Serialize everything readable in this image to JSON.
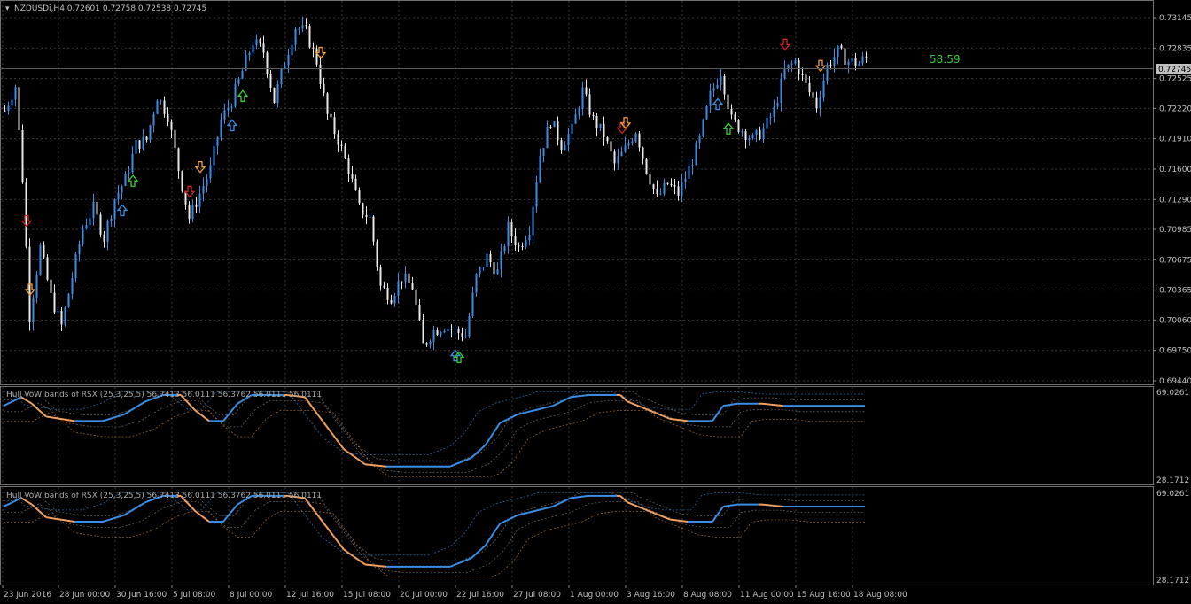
{
  "window": {
    "symbol_header": "NZDUSDi,H4  0.72601 0.72758 0.72538 0.72745",
    "timer": "58:59",
    "current_price": "0.72745"
  },
  "colors": {
    "background": "#000000",
    "grid": "#3a3a3a",
    "up_candle": "#3a8ee6",
    "down_candle": "#e8e8e8",
    "rsx_up": "#3a8ee6",
    "rsx_down": "#f0a060",
    "arrow_blue": "#3a8ee6",
    "arrow_green": "#33cc33",
    "arrow_red": "#cc2222",
    "arrow_orange": "#f0a040",
    "timer": "#33cc33"
  },
  "indicators": [
    {
      "label": "Hull VoW bands of RSX (25,3,25,5) 56.7413 56.0111 56.3762 56.0111 56.0111",
      "max": "69.0261",
      "min": "28.1712"
    },
    {
      "label": "Hull VoW bands of RSX (25,3,25,5) 56.7413 56.0111 56.3762 56.0111 56.0111",
      "max": "69.0261",
      "min": "28.1712"
    }
  ],
  "chart_data": {
    "type": "candlestick",
    "symbol": "NZDUSDi",
    "timeframe": "H4",
    "price_axis_labels": [
      "0.73145",
      "0.72835",
      "0.72525",
      "0.72220",
      "0.71910",
      "0.71600",
      "0.71290",
      "0.70985",
      "0.70675",
      "0.70365",
      "0.70060",
      "0.69750",
      "0.69440"
    ],
    "ylim": [
      0.6944,
      0.73145
    ],
    "time_axis_labels": [
      "23 Jun 2016",
      "28 Jun 00:00",
      "30 Jun 16:00",
      "5 Jul 08:00",
      "8 Jul 00:00",
      "12 Jul 16:00",
      "15 Jul 08:00",
      "20 Jul 00:00",
      "22 Jul 16:00",
      "27 Jul 08:00",
      "1 Aug 00:00",
      "3 Aug 16:00",
      "8 Aug 08:00",
      "11 Aug 00:00",
      "15 Aug 16:00",
      "18 Aug 08:00"
    ],
    "last_close": 0.72745,
    "close_path": [
      [
        0,
        0.722
      ],
      [
        3,
        0.7245
      ],
      [
        5,
        0.715
      ],
      [
        7,
        0.701
      ],
      [
        10,
        0.708
      ],
      [
        13,
        0.703
      ],
      [
        16,
        0.7
      ],
      [
        19,
        0.705
      ],
      [
        22,
        0.71
      ],
      [
        25,
        0.712
      ],
      [
        28,
        0.709
      ],
      [
        31,
        0.713
      ],
      [
        34,
        0.715
      ],
      [
        37,
        0.7185
      ],
      [
        40,
        0.719
      ],
      [
        43,
        0.7235
      ],
      [
        46,
        0.7215
      ],
      [
        49,
        0.716
      ],
      [
        52,
        0.711
      ],
      [
        55,
        0.7135
      ],
      [
        58,
        0.716
      ],
      [
        61,
        0.721
      ],
      [
        64,
        0.723
      ],
      [
        67,
        0.726
      ],
      [
        70,
        0.729
      ],
      [
        73,
        0.728
      ],
      [
        76,
        0.723
      ],
      [
        79,
        0.727
      ],
      [
        82,
        0.7305
      ],
      [
        85,
        0.73
      ],
      [
        88,
        0.727
      ],
      [
        91,
        0.7215
      ],
      [
        94,
        0.719
      ],
      [
        97,
        0.716
      ],
      [
        100,
        0.712
      ],
      [
        103,
        0.711
      ],
      [
        106,
        0.704
      ],
      [
        109,
        0.703
      ],
      [
        112,
        0.705
      ],
      [
        115,
        0.704
      ],
      [
        118,
        0.698
      ],
      [
        121,
        0.6995
      ],
      [
        124,
        0.7
      ],
      [
        127,
        0.6995
      ],
      [
        130,
        0.699
      ],
      [
        133,
        0.705
      ],
      [
        136,
        0.707
      ],
      [
        139,
        0.7055
      ],
      [
        142,
        0.71
      ],
      [
        145,
        0.708
      ],
      [
        148,
        0.71
      ],
      [
        151,
        0.7175
      ],
      [
        154,
        0.721
      ],
      [
        157,
        0.7185
      ],
      [
        160,
        0.72
      ],
      [
        163,
        0.724
      ],
      [
        166,
        0.721
      ],
      [
        169,
        0.7195
      ],
      [
        172,
        0.7165
      ],
      [
        175,
        0.718
      ],
      [
        178,
        0.72
      ],
      [
        181,
        0.716
      ],
      [
        184,
        0.713
      ],
      [
        187,
        0.7145
      ],
      [
        190,
        0.7135
      ],
      [
        193,
        0.716
      ],
      [
        196,
        0.719
      ],
      [
        199,
        0.7235
      ],
      [
        202,
        0.726
      ],
      [
        205,
        0.721
      ],
      [
        208,
        0.72
      ],
      [
        211,
        0.719
      ],
      [
        214,
        0.72
      ],
      [
        217,
        0.722
      ],
      [
        220,
        0.726
      ],
      [
        223,
        0.727
      ],
      [
        226,
        0.7245
      ],
      [
        229,
        0.7225
      ],
      [
        232,
        0.7265
      ],
      [
        235,
        0.728
      ],
      [
        238,
        0.727
      ],
      [
        241,
        0.7268
      ],
      [
        243,
        0.72745
      ]
    ],
    "signal_arrows": [
      {
        "bar": 6,
        "dir": "down",
        "color": "red"
      },
      {
        "bar": 7,
        "dir": "down",
        "color": "orange"
      },
      {
        "bar": 33,
        "dir": "up",
        "color": "blue"
      },
      {
        "bar": 36,
        "dir": "up",
        "color": "green"
      },
      {
        "bar": 52,
        "dir": "down",
        "color": "red"
      },
      {
        "bar": 55,
        "dir": "down",
        "color": "orange"
      },
      {
        "bar": 64,
        "dir": "up",
        "color": "blue"
      },
      {
        "bar": 67,
        "dir": "up",
        "color": "green"
      },
      {
        "bar": 89,
        "dir": "down",
        "color": "orange"
      },
      {
        "bar": 127,
        "dir": "up",
        "color": "blue"
      },
      {
        "bar": 128,
        "dir": "up",
        "color": "green"
      },
      {
        "bar": 174,
        "dir": "down",
        "color": "red"
      },
      {
        "bar": 175,
        "dir": "down",
        "color": "orange"
      },
      {
        "bar": 201,
        "dir": "up",
        "color": "blue"
      },
      {
        "bar": 204,
        "dir": "up",
        "color": "green"
      },
      {
        "bar": 220,
        "dir": "down",
        "color": "red"
      },
      {
        "bar": 230,
        "dir": "down",
        "color": "orange"
      }
    ],
    "rsx_path": [
      [
        0,
        62
      ],
      [
        5,
        66
      ],
      [
        8,
        63
      ],
      [
        12,
        57
      ],
      [
        20,
        55
      ],
      [
        28,
        55
      ],
      [
        34,
        58
      ],
      [
        40,
        64
      ],
      [
        45,
        67
      ],
      [
        50,
        67
      ],
      [
        54,
        60
      ],
      [
        58,
        55
      ],
      [
        62,
        55
      ],
      [
        66,
        63
      ],
      [
        70,
        67
      ],
      [
        80,
        67
      ],
      [
        85,
        66
      ],
      [
        90,
        55
      ],
      [
        96,
        42
      ],
      [
        102,
        35
      ],
      [
        108,
        34
      ],
      [
        120,
        34
      ],
      [
        126,
        34
      ],
      [
        132,
        38
      ],
      [
        136,
        44
      ],
      [
        140,
        54
      ],
      [
        145,
        58
      ],
      [
        150,
        60
      ],
      [
        155,
        62
      ],
      [
        160,
        66
      ],
      [
        165,
        67
      ],
      [
        174,
        67
      ],
      [
        176,
        64
      ],
      [
        182,
        60
      ],
      [
        188,
        56
      ],
      [
        193,
        55
      ],
      [
        200,
        55
      ],
      [
        203,
        62
      ],
      [
        207,
        63
      ],
      [
        214,
        63
      ],
      [
        220,
        62
      ],
      [
        243,
        62
      ]
    ],
    "rsx_scale": [
      28.1712,
      69.0261
    ]
  }
}
